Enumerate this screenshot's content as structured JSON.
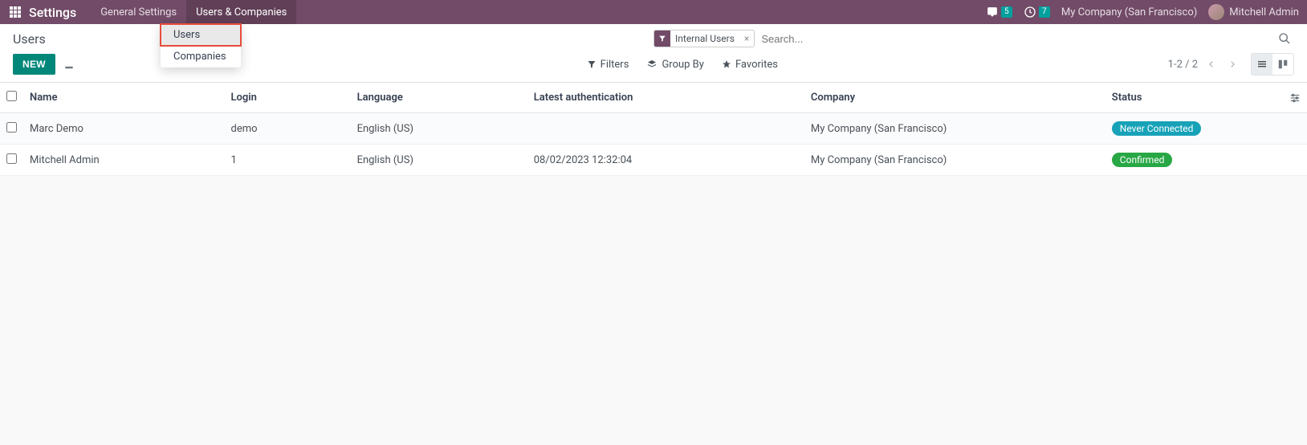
{
  "topnav": {
    "brand": "Settings",
    "items": [
      "General Settings",
      "Users & Companies"
    ],
    "active_index": 1,
    "messages_badge": "5",
    "activities_badge": "7",
    "company": "My Company (San Francisco)",
    "user": "Mitchell Admin"
  },
  "dropdown": {
    "items": [
      "Users",
      "Companies"
    ],
    "highlight_index": 0
  },
  "breadcrumb": "Users",
  "buttons": {
    "new": "NEW"
  },
  "search": {
    "facet_label": "Internal Users",
    "placeholder": "Search..."
  },
  "filters": {
    "filters": "Filters",
    "group_by": "Group By",
    "favorites": "Favorites"
  },
  "pager": {
    "text": "1-2 / 2"
  },
  "table": {
    "headers": {
      "name": "Name",
      "login": "Login",
      "language": "Language",
      "auth": "Latest authentication",
      "company": "Company",
      "status": "Status"
    },
    "rows": [
      {
        "name": "Marc Demo",
        "login": "demo",
        "language": "English (US)",
        "auth": "",
        "company": "My Company (San Francisco)",
        "status": "Never Connected",
        "status_class": "status-never"
      },
      {
        "name": "Mitchell Admin",
        "login": "1",
        "language": "English (US)",
        "auth": "08/02/2023 12:32:04",
        "company": "My Company (San Francisco)",
        "status": "Confirmed",
        "status_class": "status-confirmed"
      }
    ]
  }
}
